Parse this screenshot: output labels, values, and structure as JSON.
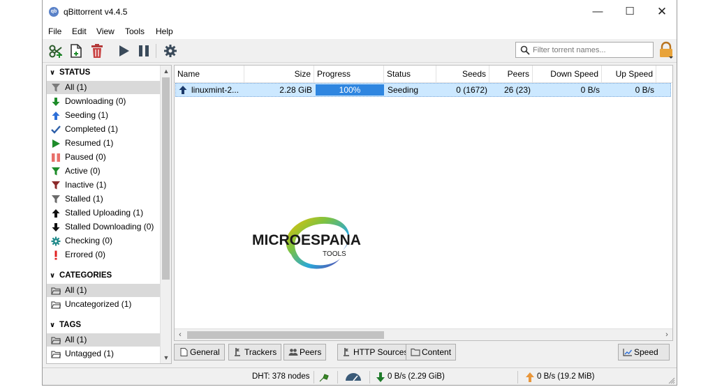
{
  "window": {
    "title": "qBittorrent v4.4.5",
    "app_icon_text": "qb",
    "minimize": "—",
    "maximize": "☐",
    "close": "✕"
  },
  "menu": [
    "File",
    "Edit",
    "View",
    "Tools",
    "Help"
  ],
  "toolbar": {
    "icons": [
      "add-link-icon",
      "add-file-icon",
      "delete-icon",
      "resume-icon",
      "pause-icon",
      "options-gear-icon"
    ],
    "search_placeholder": "Filter torrent names..."
  },
  "sidebar": {
    "status_header": "STATUS",
    "status_items": [
      {
        "label": "All (1)",
        "icon": "filter-icon",
        "color": "#7a7a7a"
      },
      {
        "label": "Downloading (0)",
        "icon": "arrow-down-icon",
        "color": "#1e8c2a"
      },
      {
        "label": "Seeding (1)",
        "icon": "arrow-up-icon",
        "color": "#2d6fd8"
      },
      {
        "label": "Completed (1)",
        "icon": "checkmark-icon",
        "color": "#2d5fa8"
      },
      {
        "label": "Resumed (1)",
        "icon": "play-icon",
        "color": "#1e8c2a"
      },
      {
        "label": "Paused (0)",
        "icon": "pause-icon",
        "color": "#e8706a"
      },
      {
        "label": "Active (0)",
        "icon": "filter-icon",
        "color": "#1e8c2a"
      },
      {
        "label": "Inactive (1)",
        "icon": "filter-icon",
        "color": "#8b2a2a"
      },
      {
        "label": "Stalled (1)",
        "icon": "filter-icon",
        "color": "#6a6a6a"
      },
      {
        "label": "Stalled Uploading (1)",
        "icon": "arrow-up-icon",
        "color": "#111111"
      },
      {
        "label": "Stalled Downloading (0)",
        "icon": "arrow-down-icon",
        "color": "#111111"
      },
      {
        "label": "Checking (0)",
        "icon": "gear-icon",
        "color": "#1f8a8a"
      },
      {
        "label": "Errored (0)",
        "icon": "error-icon",
        "color": "#e02020"
      }
    ],
    "categories_header": "CATEGORIES",
    "category_items": [
      {
        "label": "All (1)"
      },
      {
        "label": "Uncategorized (1)"
      }
    ],
    "tags_header": "TAGS",
    "tag_items": [
      {
        "label": "All (1)"
      },
      {
        "label": "Untagged (1)"
      }
    ]
  },
  "table": {
    "columns": [
      "Name",
      "Size",
      "Progress",
      "Status",
      "Seeds",
      "Peers",
      "Down Speed",
      "Up Speed"
    ],
    "rows": [
      {
        "name": "linuxmint-2...",
        "size": "2.28 GiB",
        "progress_text": "100%",
        "progress": 1.0,
        "status": "Seeding",
        "seeds": "0 (1672)",
        "peers": "26 (23)",
        "down_speed": "0 B/s",
        "up_speed": "0 B/s"
      }
    ]
  },
  "properties_tabs": [
    "General",
    "Trackers",
    "Peers",
    "HTTP Sources",
    "Content"
  ],
  "speed_button": "Speed",
  "watermark": {
    "line1": "MICROESPANA",
    "line2": "TOOLS"
  },
  "statusbar": {
    "dht": "DHT: 378 nodes",
    "download": "0 B/s (2.29 GiB)",
    "upload": "0 B/s (19.2 MiB)"
  },
  "colors": {
    "selection": "#cce8ff",
    "progress": "#2f86e0",
    "accent_lock": "#e8a33a"
  }
}
